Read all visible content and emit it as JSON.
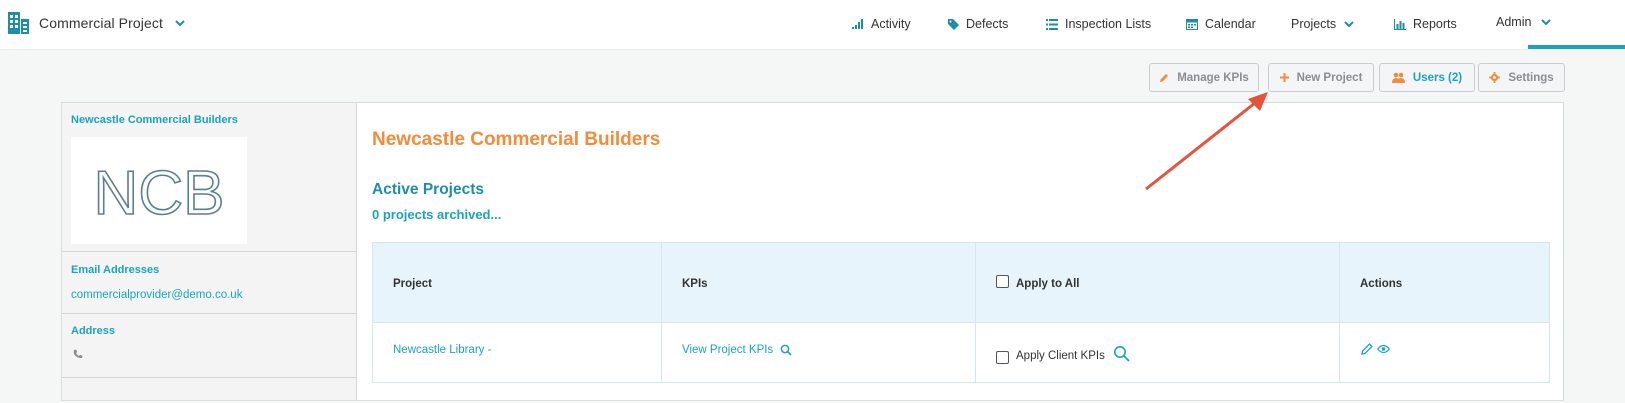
{
  "header": {
    "project_name": "Commercial Project",
    "nav": {
      "activity": "Activity",
      "defects": "Defects",
      "inspection_lists": "Inspection Lists",
      "calendar": "Calendar",
      "projects": "Projects",
      "reports": "Reports",
      "admin": "Admin"
    },
    "active_nav": "admin"
  },
  "toolbar": {
    "manage_kpis": "Manage KPIs",
    "new_project": "New Project",
    "users": "Users (2)",
    "settings": "Settings"
  },
  "sidebar": {
    "company_name": "Newcastle Commercial Builders",
    "logo_text": "NCB",
    "email_heading": "Email Addresses",
    "email": "commercialprovider@demo.co.uk",
    "address_heading": "Address"
  },
  "main": {
    "company_title": "Newcastle Commercial Builders",
    "active_projects_heading": "Active Projects",
    "archived_link": "0 projects archived..."
  },
  "table": {
    "headers": {
      "project": "Project",
      "kpis": "KPIs",
      "apply_to_all": "Apply to All",
      "actions": "Actions"
    },
    "rows": [
      {
        "project": "Newcastle Library -",
        "kpis_link": "View Project KPIs",
        "apply_label": "Apply Client KPIs"
      }
    ]
  },
  "colors": {
    "accent": "#19a3bf",
    "company_title": "#f28c3a",
    "annotation_arrow": "#e5533d"
  }
}
